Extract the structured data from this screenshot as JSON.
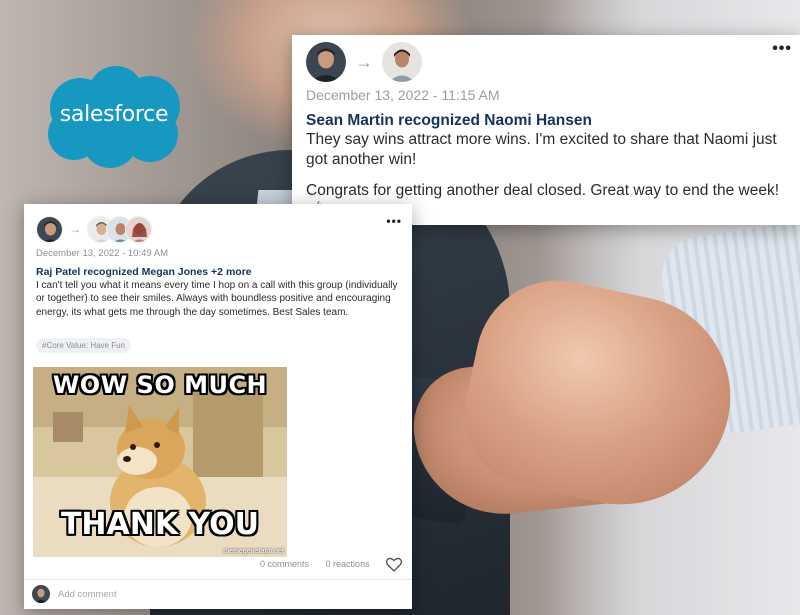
{
  "brand": {
    "logo_text": "salesforce",
    "logo_color": "#1798c1"
  },
  "post_top": {
    "date": "December 13, 2022 - 11:15 AM",
    "title": "Sean Martin recognized Naomi Hansen",
    "body_line1": "They say wins attract more wins. I'm excited to share that Naomi just got another win!",
    "body_line2": "Congrats for getting another deal closed. Great way to end the week!",
    "more_icon": "more-options-icon",
    "accent_color": "#16325c"
  },
  "post_left": {
    "date": "December 13, 2022 - 10:49 AM",
    "title": "Raj Patel recognized Megan Jones +2 more",
    "body": "I can't tell you what it means every time I hop on a call with this group (individually or together) to see their smiles. Always with boundless positive and encouraging energy, its what gets me through the day sometimes. Best Sales team.",
    "tag": "#Core Value: Have Fun",
    "meme_top": "WOW SO MUCH",
    "meme_bottom": "THANK YOU",
    "meme_credit": "memegenerator.net",
    "comments": "0 comments",
    "reactions": "0 reactions",
    "comment_placeholder": "Add comment"
  }
}
